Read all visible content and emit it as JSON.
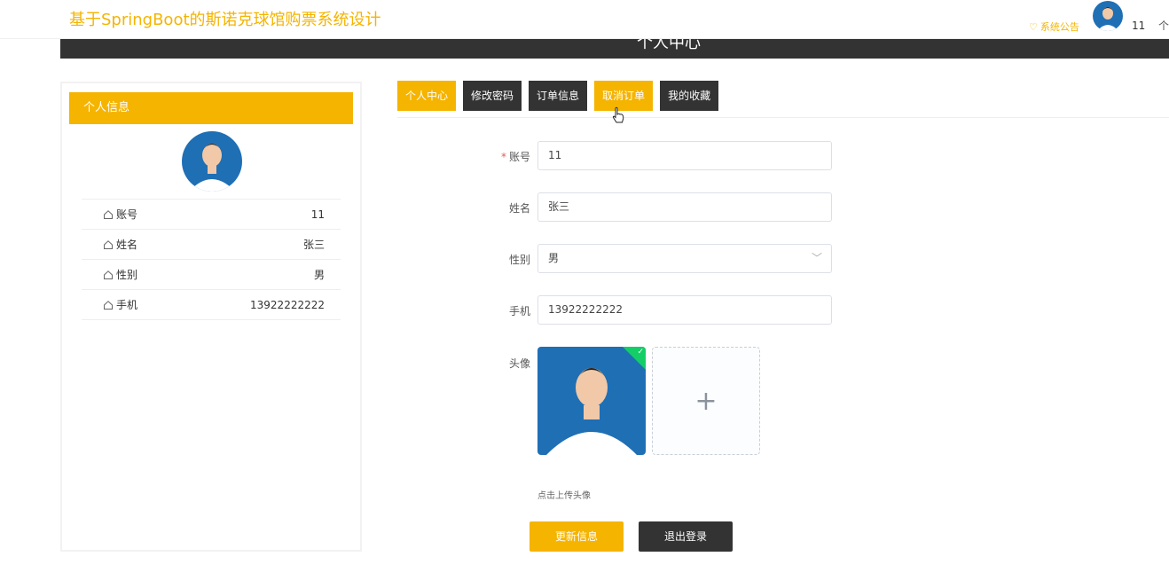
{
  "header": {
    "site_title": "基于SpringBoot的斯诺克球馆购票系统设计",
    "notice_label": "系统公告",
    "username": "11",
    "more_glyph": "个"
  },
  "banner": {
    "title": "个人中心"
  },
  "profile_card": {
    "title": "个人信息",
    "rows": [
      {
        "label": "账号",
        "value": "11"
      },
      {
        "label": "姓名",
        "value": "张三"
      },
      {
        "label": "性别",
        "value": "男"
      },
      {
        "label": "手机",
        "value": "13922222222"
      }
    ]
  },
  "tabs": [
    {
      "label": "个人中心",
      "active": true
    },
    {
      "label": "修改密码",
      "active": false
    },
    {
      "label": "订单信息",
      "active": false
    },
    {
      "label": "取消订单",
      "active": false
    },
    {
      "label": "我的收藏",
      "active": false
    }
  ],
  "form": {
    "account_label": "账号",
    "account_required_mark": "*",
    "account_value": "11",
    "name_label": "姓名",
    "name_value": "张三",
    "gender_label": "性别",
    "gender_value": "男",
    "phone_label": "手机",
    "phone_value": "13922222222",
    "avatar_label": "头像",
    "upload_plus": "+",
    "upload_hint": "点击上传头像",
    "update_button": "更新信息",
    "logout_button": "退出登录"
  },
  "colors": {
    "accent": "#f5b400",
    "dark": "#333333",
    "success": "#13ce66"
  },
  "icons": {
    "notice": "heart-icon",
    "row": "home-icon",
    "select": "chevron-down-icon",
    "cursor": "hand-pointer-icon"
  }
}
